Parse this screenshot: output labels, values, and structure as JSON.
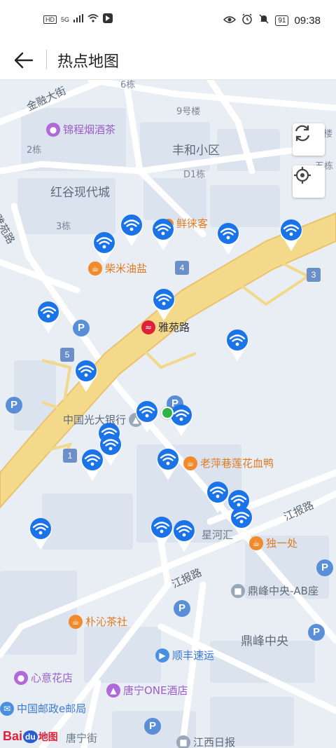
{
  "status_bar": {
    "left_icons": [
      "HD",
      "5G"
    ],
    "battery": "91",
    "time": "09:38"
  },
  "header": {
    "title": "热点地图"
  },
  "map": {
    "labels": [
      {
        "id": "6dong",
        "text": "6栋"
      },
      {
        "id": "jinrong",
        "text": "金融大街"
      },
      {
        "id": "9hao",
        "text": "9号楼"
      },
      {
        "id": "2dong",
        "text": "2栋"
      },
      {
        "id": "fenghe",
        "text": "丰和小区"
      },
      {
        "id": "d1",
        "text": "D1栋"
      },
      {
        "id": "wudong",
        "text": "五栋"
      },
      {
        "id": "lou",
        "text": "楼"
      },
      {
        "id": "honggu",
        "text": "红谷现代城"
      },
      {
        "id": "yayuan_road",
        "text": "雅苑路"
      },
      {
        "id": "3dong",
        "text": "3栋"
      },
      {
        "id": "jiangbao1",
        "text": "江报路"
      },
      {
        "id": "jiangbao2",
        "text": "江报路"
      },
      {
        "id": "xinghehui",
        "text": "星河汇"
      },
      {
        "id": "dingfeng",
        "text": "鼎峰中央"
      },
      {
        "id": "tangning",
        "text": "唐宁街"
      }
    ],
    "pois": [
      {
        "id": "jincheng",
        "text": "锦程烟酒茶"
      },
      {
        "id": "xianlaike",
        "text": "鲜徕客"
      },
      {
        "id": "chaimi",
        "text": "柴米油盐"
      },
      {
        "id": "yayuan_station",
        "text": "雅苑路"
      },
      {
        "id": "guangda",
        "text": "中国光大银行"
      },
      {
        "id": "laoping",
        "text": "老萍巷莲花血鸭"
      },
      {
        "id": "duyichu",
        "text": "独一处"
      },
      {
        "id": "dingfeng_ab",
        "text": "鼎峰中央-AB座"
      },
      {
        "id": "puqin",
        "text": "朴沁茶社"
      },
      {
        "id": "shunfeng",
        "text": "顺丰速运"
      },
      {
        "id": "xinyi",
        "text": "心意花店"
      },
      {
        "id": "tangning_one",
        "text": "唐宁ONE酒店"
      },
      {
        "id": "youzheng",
        "text": "中国邮政e邮局"
      },
      {
        "id": "jiangxi",
        "text": "江西日报"
      }
    ],
    "route_numbers": [
      "4",
      "3",
      "5",
      "1"
    ],
    "parking_label": "P",
    "logo": {
      "bai": "Bai",
      "du": "du",
      "ditu": "地图"
    }
  },
  "colors": {
    "wifi_pin": "#1a73e8",
    "main_road": "#f5d98b",
    "current_location": "#2fb344",
    "map_bg": "#e9eef4"
  },
  "icons": {
    "back": "arrow-left-icon",
    "refresh": "refresh-icon",
    "locate": "locate-icon",
    "wifi": "wifi-pin-icon"
  }
}
